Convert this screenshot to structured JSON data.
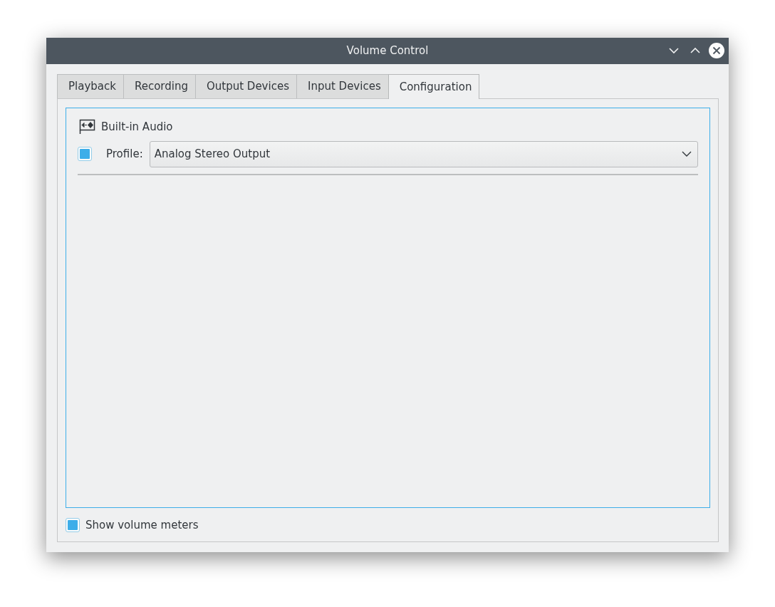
{
  "window": {
    "title": "Volume Control"
  },
  "tabs": [
    {
      "label": "Playback",
      "selected": false
    },
    {
      "label": "Recording",
      "selected": false
    },
    {
      "label": "Output Devices",
      "selected": false
    },
    {
      "label": "Input Devices",
      "selected": false
    },
    {
      "label": "Configuration",
      "selected": true
    }
  ],
  "card": {
    "name": "Built-in Audio",
    "enabled": {
      "checked": true
    },
    "profile_label": "Profile:",
    "profile_value": "Analog Stereo Output"
  },
  "show_volume_meters": {
    "label": "Show volume meters",
    "checked": true
  }
}
